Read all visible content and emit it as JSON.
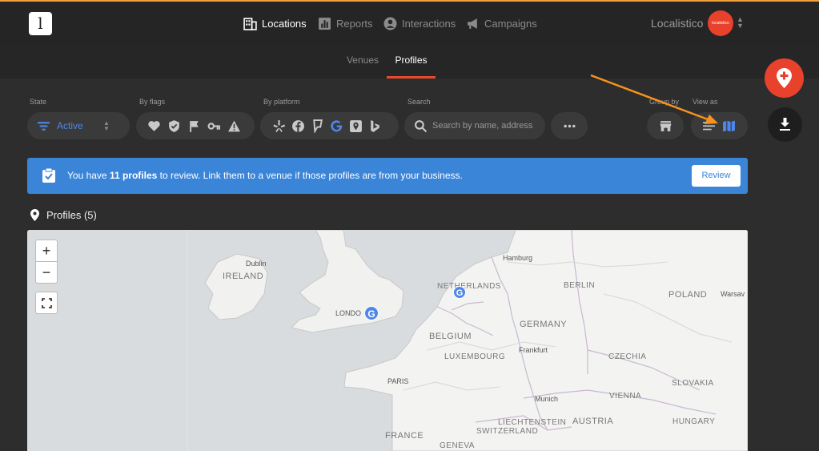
{
  "header": {
    "logo": "l",
    "nav": [
      {
        "label": "Locations",
        "icon": "building-icon",
        "active": true
      },
      {
        "label": "Reports",
        "icon": "bar-chart-icon",
        "active": false
      },
      {
        "label": "Interactions",
        "icon": "person-icon",
        "active": false
      },
      {
        "label": "Campaigns",
        "icon": "megaphone-icon",
        "active": false
      }
    ],
    "account_name": "Localistico",
    "avatar_text": "localistico"
  },
  "subtabs": [
    {
      "label": "Venues",
      "active": false
    },
    {
      "label": "Profiles",
      "active": true
    }
  ],
  "filters": {
    "state_label": "State",
    "state_value": "Active",
    "flags_label": "By flags",
    "platform_label": "By platform",
    "search_label": "Search",
    "search_placeholder": "Search by name, address",
    "group_label": "Group by",
    "view_label": "View as"
  },
  "banner": {
    "prefix": "You have ",
    "count": "11 profiles",
    "suffix": " to review. Link them to a venue if those profiles are from your business.",
    "button": "Review"
  },
  "profiles_title": "Profiles (5)",
  "map": {
    "zoom_in": "+",
    "zoom_out": "−",
    "labels": [
      {
        "key": "dublin",
        "text": "Dublin"
      },
      {
        "key": "ireland",
        "text": "IRELAND"
      },
      {
        "key": "london",
        "text": "LONDO"
      },
      {
        "key": "netherlands",
        "text": "NETHERLANDS"
      },
      {
        "key": "hamburg",
        "text": "Hamburg"
      },
      {
        "key": "berlin",
        "text": "BERLIN"
      },
      {
        "key": "poland",
        "text": "POLAND"
      },
      {
        "key": "warsaw",
        "text": "Warsav"
      },
      {
        "key": "belgium",
        "text": "BELGIUM"
      },
      {
        "key": "germany",
        "text": "GERMANY"
      },
      {
        "key": "luxembourg",
        "text": "LUXEMBOURG"
      },
      {
        "key": "frankfurt",
        "text": "Frankfurt"
      },
      {
        "key": "czechia",
        "text": "CZECHIA"
      },
      {
        "key": "paris",
        "text": "PARIS"
      },
      {
        "key": "slovakia",
        "text": "SLOVAKIA"
      },
      {
        "key": "munich",
        "text": "Munich"
      },
      {
        "key": "vienna",
        "text": "VIENNA"
      },
      {
        "key": "liechtenstein",
        "text": "LIECHTENSTEIN"
      },
      {
        "key": "austria",
        "text": "AUSTRIA"
      },
      {
        "key": "hungary",
        "text": "HUNGARY"
      },
      {
        "key": "switzerland",
        "text": "SWITZERLAND"
      },
      {
        "key": "france",
        "text": "FRANCE"
      },
      {
        "key": "geneva",
        "text": "GENEVA"
      }
    ],
    "pins": [
      {
        "name": "london-profile",
        "platform": "google",
        "letter": "G"
      },
      {
        "name": "netherlands-profile",
        "platform": "google",
        "letter": "G"
      }
    ]
  },
  "colors": {
    "accent": "#e8412c",
    "banner": "#3b85d9",
    "active_blue": "#4f87e8",
    "arrow": "#f5931e"
  }
}
